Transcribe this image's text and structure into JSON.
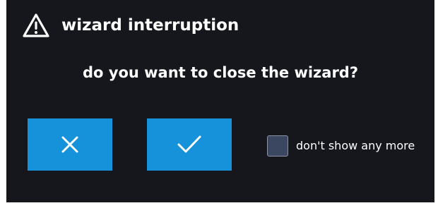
{
  "dialog": {
    "icon": "warning-icon",
    "title": "wizard interruption",
    "message": "do you want to close the wizard?",
    "buttons": {
      "cancel_icon": "close-icon",
      "confirm_icon": "check-icon"
    },
    "dont_show": {
      "label": "don't show any more",
      "checked": false
    }
  },
  "colors": {
    "background": "#15171d",
    "button": "#1592da",
    "checkbox": "#3b4660",
    "text": "#ffffff"
  }
}
